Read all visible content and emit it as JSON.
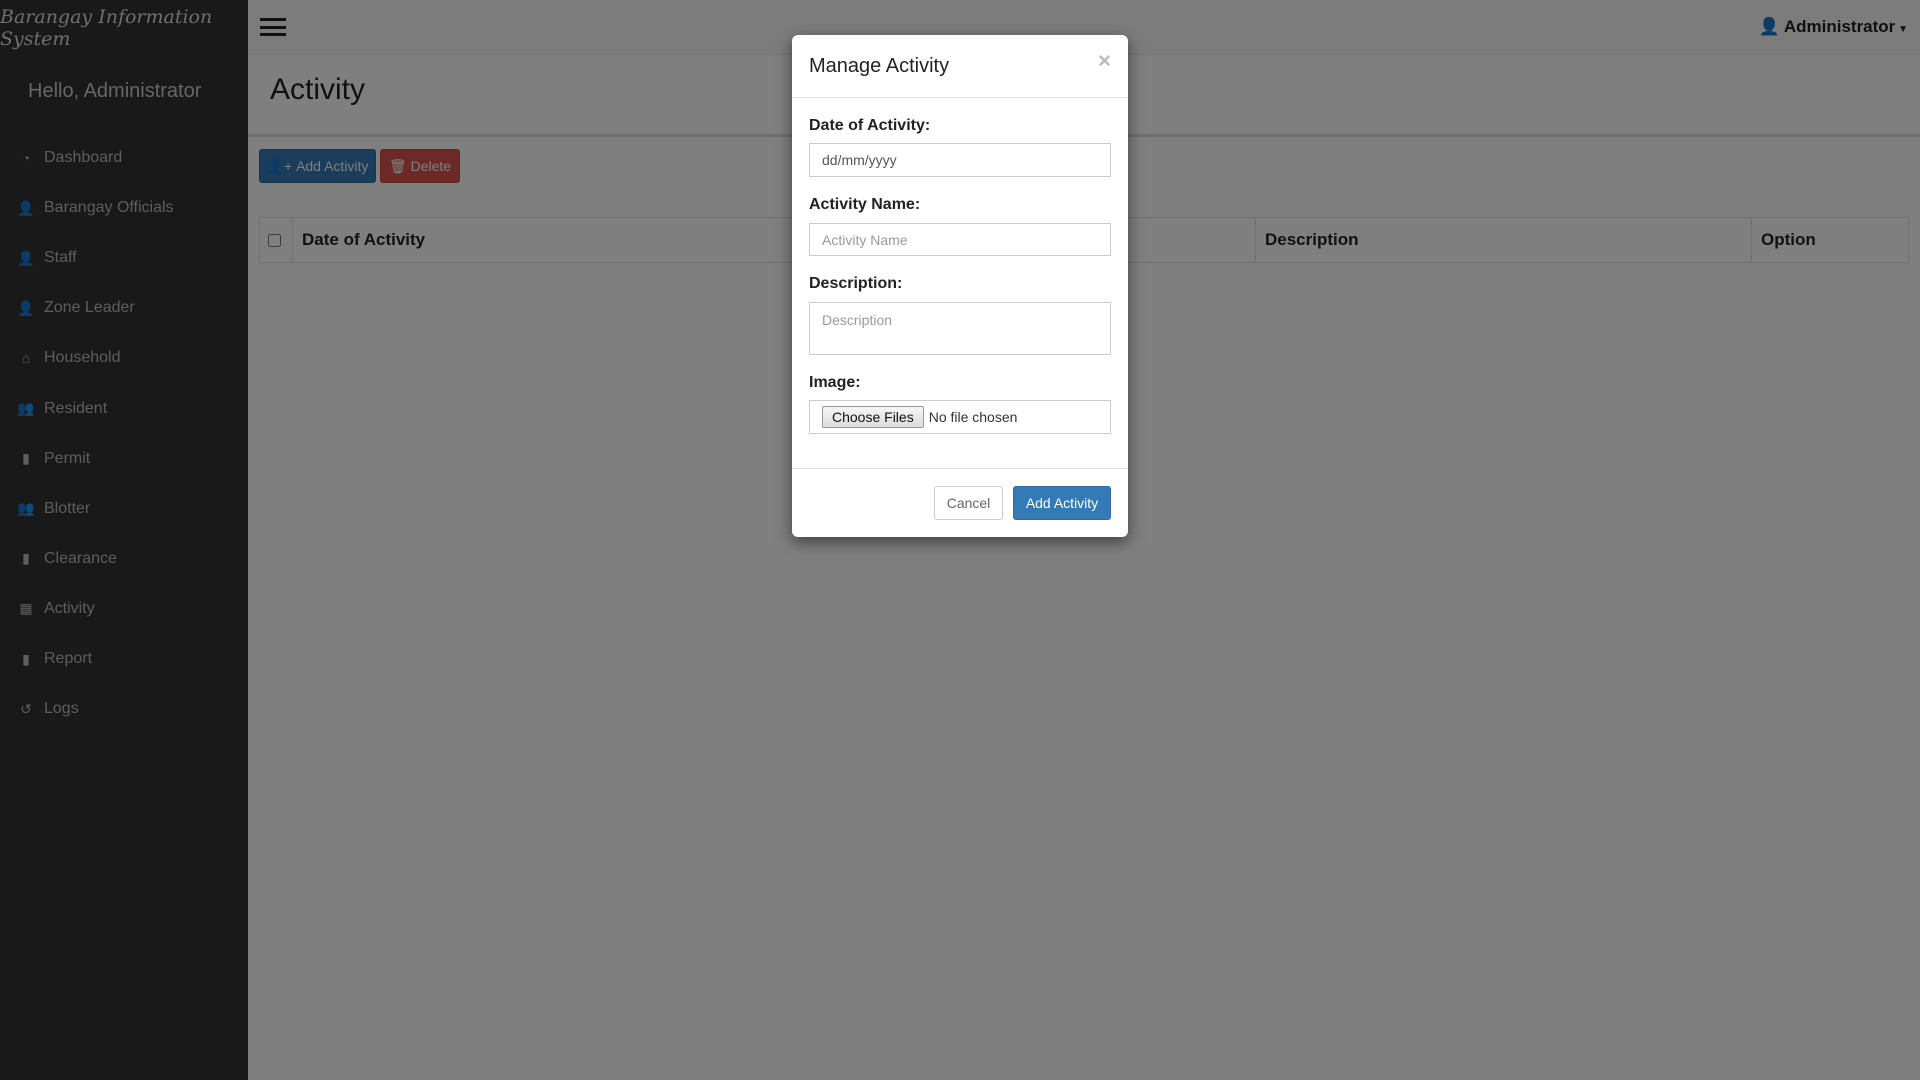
{
  "brand": "Barangay Information System",
  "greeting": "Hello, Administrator",
  "user_menu": "Administrator",
  "sidebar": {
    "items": [
      {
        "label": "Dashboard",
        "icon": "dashboard-icon",
        "glyph": "◔"
      },
      {
        "label": "Barangay Officials",
        "icon": "user-icon",
        "glyph": "👤"
      },
      {
        "label": "Staff",
        "icon": "user-icon",
        "glyph": "👤"
      },
      {
        "label": "Zone Leader",
        "icon": "user-icon",
        "glyph": "👤"
      },
      {
        "label": "Household",
        "icon": "home-icon",
        "glyph": "⌂"
      },
      {
        "label": "Resident",
        "icon": "users-icon",
        "glyph": "👥"
      },
      {
        "label": "Permit",
        "icon": "file-icon",
        "glyph": "▮"
      },
      {
        "label": "Blotter",
        "icon": "users-icon",
        "glyph": "👥"
      },
      {
        "label": "Clearance",
        "icon": "file-icon",
        "glyph": "▮"
      },
      {
        "label": "Activity",
        "icon": "calendar-icon",
        "glyph": "▦"
      },
      {
        "label": "Report",
        "icon": "file-icon",
        "glyph": "▮"
      },
      {
        "label": "Logs",
        "icon": "history-icon",
        "glyph": "↺"
      }
    ]
  },
  "page": {
    "title": "Activity",
    "add_button": "Add Activity",
    "delete_button": "Delete"
  },
  "table": {
    "columns": [
      "Date of Activity",
      "",
      "Description",
      "Option"
    ]
  },
  "modal": {
    "title": "Manage Activity",
    "close": "×",
    "date_label": "Date of Activity:",
    "date_placeholder": "dd/mm/yyyy",
    "name_label": "Activity Name:",
    "name_placeholder": "Activity Name",
    "desc_label": "Description:",
    "desc_placeholder": "Description",
    "image_label": "Image:",
    "file_button": "Choose Files",
    "file_status": "No file chosen",
    "cancel": "Cancel",
    "submit": "Add Activity"
  },
  "colors": {
    "primary": "#337ab7",
    "danger": "#d9534f",
    "sidebar": "#333333"
  }
}
